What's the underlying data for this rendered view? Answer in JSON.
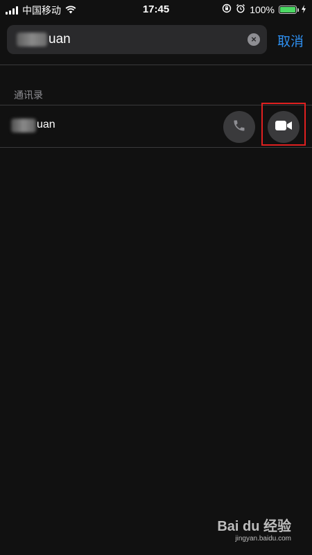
{
  "status_bar": {
    "carrier": "中国移动",
    "time": "17:45",
    "battery_percent": "100%",
    "battery_level": 1.0,
    "battery_color": "#4cd964"
  },
  "search": {
    "value": "uan",
    "cancel_label": "取消",
    "clear_icon": "×"
  },
  "results": {
    "section_title": "通讯录",
    "contacts": [
      {
        "name": "uan"
      }
    ]
  },
  "colors": {
    "background": "#111111",
    "accent": "#2e8ff0",
    "highlight": "#e02020"
  },
  "watermark": {
    "main": "Bai du 经验",
    "sub": "jingyan.baidu.com"
  }
}
